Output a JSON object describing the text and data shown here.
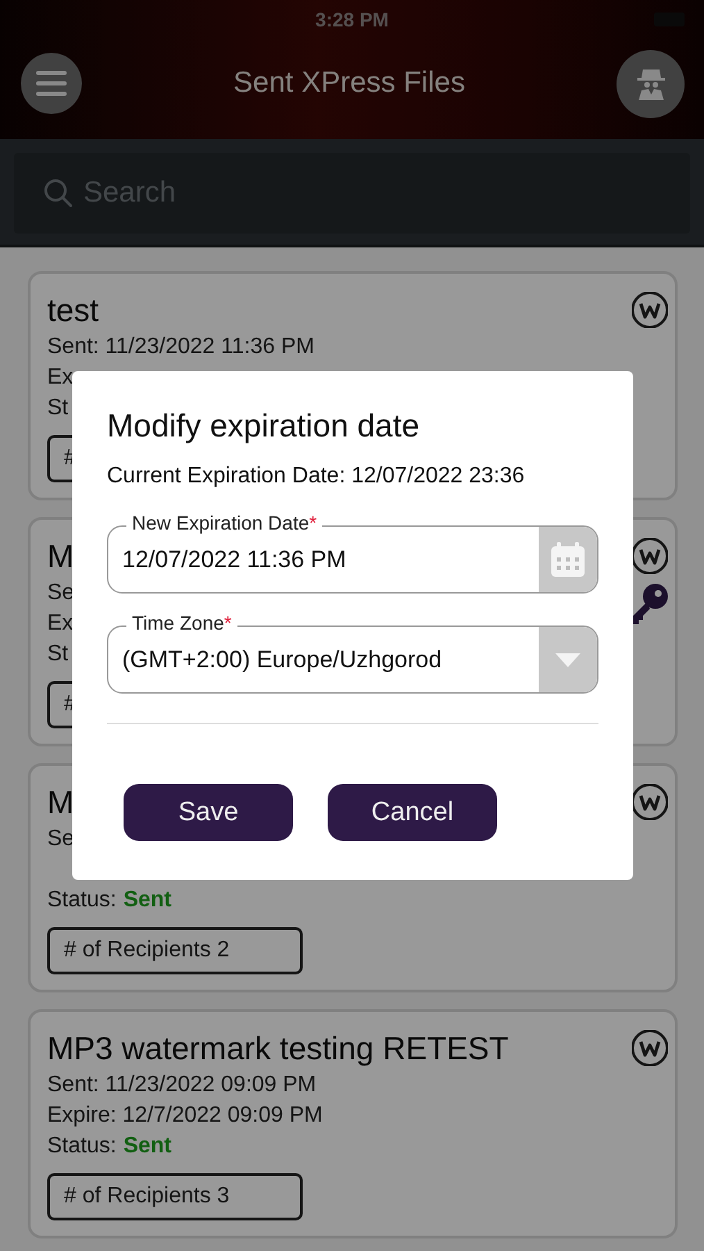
{
  "status_bar": {
    "time": "3:28 PM"
  },
  "header": {
    "title": "Sent XPress Files"
  },
  "search": {
    "placeholder": "Search"
  },
  "cards": [
    {
      "title": "test",
      "sent": "Sent: 11/23/2022 11:36 PM",
      "expire": "Ex",
      "status_label": "St",
      "recipients": "#",
      "protected": false
    },
    {
      "title": "M",
      "sent": "Se",
      "expire": "Ex",
      "status_label": "St",
      "recipients": "#",
      "protected": true
    },
    {
      "title": "M",
      "sent": "Se",
      "status_label": "Status:",
      "status": "Sent",
      "recipients": "# of Recipients 2",
      "protected": false
    },
    {
      "title": "MP3 watermark testing RETEST",
      "sent": "Sent: 11/23/2022 09:09 PM",
      "expire": "Expire: 12/7/2022 09:09 PM",
      "status_label": "Status:",
      "status": "Sent",
      "recipients": "# of Recipients 3",
      "protected": false
    }
  ],
  "dialog": {
    "title": "Modify expiration date",
    "current": "Current Expiration Date: 12/07/2022 23:36",
    "fields": [
      {
        "kind": "date",
        "label": "New Expiration Date",
        "required_mark": "*",
        "value": "12/07/2022 11:36 PM"
      },
      {
        "kind": "select",
        "label": "Time Zone",
        "required_mark": "*",
        "value": "(GMT+2:00) Europe/Uzhgorod"
      }
    ],
    "buttons": [
      "Save",
      "Cancel"
    ]
  }
}
